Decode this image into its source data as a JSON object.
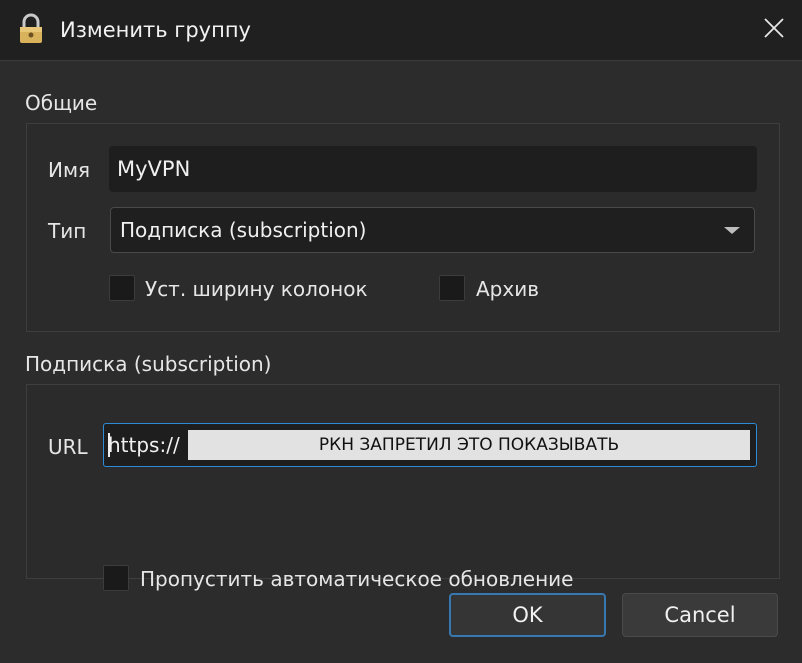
{
  "window": {
    "title": "Изменить группу",
    "icon": "lock-icon",
    "close_icon": "close-icon"
  },
  "general": {
    "label": "Общие",
    "name_label": "Имя",
    "name_value": "MyVPN",
    "type_label": "Тип",
    "type_value": "Подписка (subscription)",
    "col_width_label": "Уст. ширину колонок",
    "col_width_checked": false,
    "archive_label": "Архив",
    "archive_checked": false
  },
  "subscription": {
    "label": "Подписка (subscription)",
    "url_label": "URL",
    "url_prefix": "https://",
    "url_redaction_text": "РКН ЗАПРЕТИЛ ЭТО ПОКАЗЫВАТЬ",
    "skip_update_label": "Пропустить автоматическое обновление",
    "skip_update_checked": false
  },
  "buttons": {
    "ok": "OK",
    "cancel": "Cancel"
  },
  "colors": {
    "accent": "#2f8ad6",
    "background": "#2c2c2c",
    "titlebar": "#202020"
  }
}
